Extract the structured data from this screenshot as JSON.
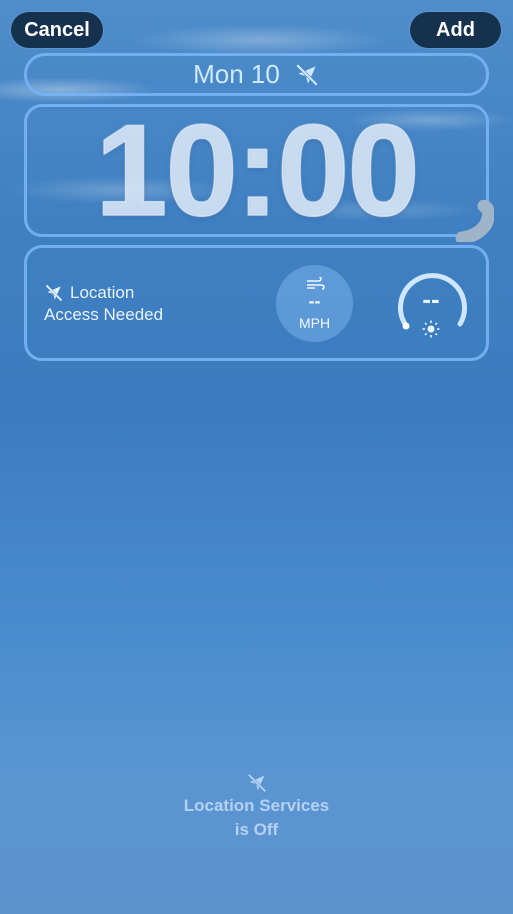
{
  "toolbar": {
    "cancel_label": "Cancel",
    "add_label": "Add"
  },
  "date_widget": {
    "text": "Mon 10"
  },
  "clock": {
    "time": "10:00"
  },
  "location_widget": {
    "line1": "Location",
    "line2": "Access Needed"
  },
  "wind_widget": {
    "value": "--",
    "unit": "MPH"
  },
  "uv_widget": {
    "value": "--"
  },
  "footer": {
    "line1": "Location Services",
    "line2": "is Off"
  },
  "icons": [
    "location-off-icon",
    "wind-icon",
    "sun-icon"
  ]
}
